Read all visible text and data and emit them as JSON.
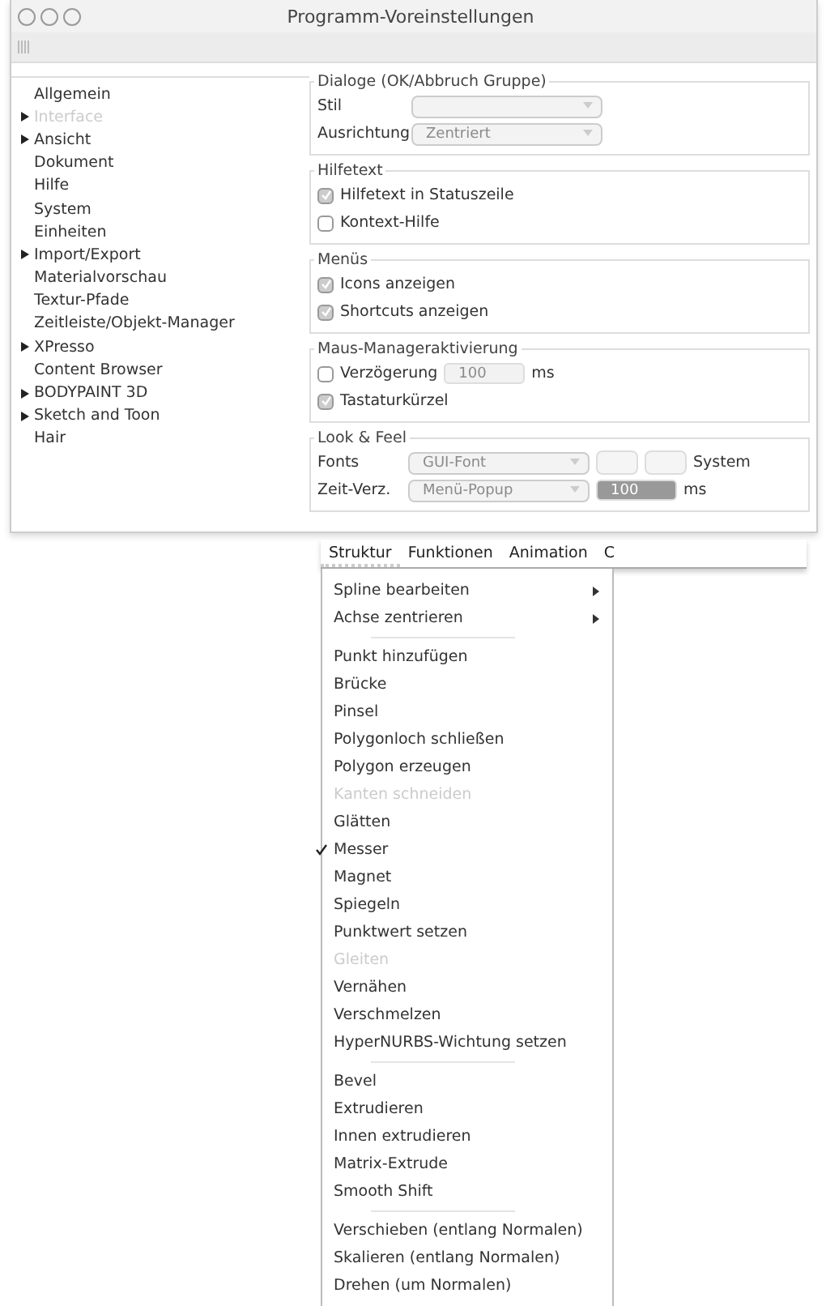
{
  "window": {
    "title": "Programm-Voreinstellungen"
  },
  "sidebar": {
    "items": [
      {
        "label": "Allgemein",
        "expandable": false,
        "disabled": false
      },
      {
        "label": "Interface",
        "expandable": true,
        "disabled": true
      },
      {
        "label": "Ansicht",
        "expandable": true,
        "disabled": false
      },
      {
        "label": "Dokument",
        "expandable": false,
        "disabled": false
      },
      {
        "label": "Hilfe",
        "expandable": false,
        "disabled": false
      },
      {
        "label": "System",
        "expandable": false,
        "disabled": false
      },
      {
        "label": "Einheiten",
        "expandable": false,
        "disabled": false
      },
      {
        "label": "Import/Export",
        "expandable": true,
        "disabled": false
      },
      {
        "label": "Materialvorschau",
        "expandable": false,
        "disabled": false
      },
      {
        "label": "Textur-Pfade",
        "expandable": false,
        "disabled": false
      },
      {
        "label": "Zeitleiste/Objekt-Manager",
        "expandable": false,
        "disabled": false
      },
      {
        "label": "XPresso",
        "expandable": true,
        "disabled": false
      },
      {
        "label": "Content Browser",
        "expandable": false,
        "disabled": false
      },
      {
        "label": "BODYPAINT 3D",
        "expandable": true,
        "disabled": false
      },
      {
        "label": "Sketch and Toon",
        "expandable": true,
        "disabled": false
      },
      {
        "label": "Hair",
        "expandable": false,
        "disabled": false
      }
    ]
  },
  "groups": [
    {
      "title": "Dialoge (OK/Abbruch Gruppe)",
      "rows": [
        {
          "kind": "select",
          "label": "Stil"
        },
        {
          "kind": "select",
          "label": "Ausrichtung",
          "value": "Zentriert"
        }
      ]
    },
    {
      "title": "Hilfetext",
      "rows": [
        {
          "kind": "checkbox",
          "label": "Hilfetext in Statuszeile",
          "checked": true
        },
        {
          "kind": "checkbox",
          "label": "Kontext-Hilfe",
          "checked": false
        }
      ]
    },
    {
      "title": "Menüs",
      "rows": [
        {
          "kind": "checkbox",
          "label": "Icons anzeigen",
          "checked": true
        },
        {
          "kind": "checkbox",
          "label": "Shortcuts anzeigen",
          "checked": true
        }
      ]
    },
    {
      "title": "Maus-Manageraktivierung",
      "rows": [
        {
          "kind": "checkbox_number",
          "label": "Verzögerung",
          "checked": false,
          "value": "100",
          "unit": "ms"
        },
        {
          "kind": "checkbox",
          "label": "Tastaturkürzel",
          "checked": true
        }
      ]
    },
    {
      "title": "Look & Feel",
      "rows": [
        {
          "kind": "font",
          "label": "Fonts",
          "value": "GUI-Font",
          "suffix": "System"
        },
        {
          "kind": "select_number",
          "label": "Zeit-Verz.",
          "value": "Menü-Popup",
          "number": "100",
          "unit": "ms"
        }
      ]
    }
  ],
  "menubar": [
    {
      "label": "Struktur",
      "selected": true
    },
    {
      "label": "Funktionen",
      "selected": false
    },
    {
      "label": "Animation",
      "selected": false
    },
    {
      "label": "C",
      "selected": false
    }
  ],
  "menu": [
    {
      "kind": "item",
      "label": "Spline bearbeiten",
      "submenu": true,
      "disabled": false,
      "checked": false
    },
    {
      "kind": "item",
      "label": "Achse zentrieren",
      "submenu": true,
      "disabled": false,
      "checked": false
    },
    {
      "kind": "separator"
    },
    {
      "kind": "item",
      "label": "Punkt hinzufügen",
      "submenu": false,
      "disabled": false,
      "checked": false
    },
    {
      "kind": "item",
      "label": "Brücke",
      "submenu": false,
      "disabled": false,
      "checked": false
    },
    {
      "kind": "item",
      "label": "Pinsel",
      "submenu": false,
      "disabled": false,
      "checked": false
    },
    {
      "kind": "item",
      "label": "Polygonloch schließen",
      "submenu": false,
      "disabled": false,
      "checked": false
    },
    {
      "kind": "item",
      "label": "Polygon erzeugen",
      "submenu": false,
      "disabled": false,
      "checked": false
    },
    {
      "kind": "item",
      "label": "Kanten schneiden",
      "submenu": false,
      "disabled": true,
      "checked": false
    },
    {
      "kind": "item",
      "label": "Glätten",
      "submenu": false,
      "disabled": false,
      "checked": false
    },
    {
      "kind": "item",
      "label": "Messer",
      "submenu": false,
      "disabled": false,
      "checked": true
    },
    {
      "kind": "item",
      "label": "Magnet",
      "submenu": false,
      "disabled": false,
      "checked": false
    },
    {
      "kind": "item",
      "label": "Spiegeln",
      "submenu": false,
      "disabled": false,
      "checked": false
    },
    {
      "kind": "item",
      "label": "Punktwert setzen",
      "submenu": false,
      "disabled": false,
      "checked": false
    },
    {
      "kind": "item",
      "label": "Gleiten",
      "submenu": false,
      "disabled": true,
      "checked": false
    },
    {
      "kind": "item",
      "label": "Vernähen",
      "submenu": false,
      "disabled": false,
      "checked": false
    },
    {
      "kind": "item",
      "label": "Verschmelzen",
      "submenu": false,
      "disabled": false,
      "checked": false
    },
    {
      "kind": "item",
      "label": "HyperNURBS-Wichtung setzen",
      "submenu": false,
      "disabled": false,
      "checked": false
    },
    {
      "kind": "separator"
    },
    {
      "kind": "item",
      "label": "Bevel",
      "submenu": false,
      "disabled": false,
      "checked": false
    },
    {
      "kind": "item",
      "label": "Extrudieren",
      "submenu": false,
      "disabled": false,
      "checked": false
    },
    {
      "kind": "item",
      "label": "Innen extrudieren",
      "submenu": false,
      "disabled": false,
      "checked": false
    },
    {
      "kind": "item",
      "label": "Matrix-Extrude",
      "submenu": false,
      "disabled": false,
      "checked": false
    },
    {
      "kind": "item",
      "label": "Smooth Shift",
      "submenu": false,
      "disabled": false,
      "checked": false
    },
    {
      "kind": "separator"
    },
    {
      "kind": "item",
      "label": "Verschieben (entlang Normalen)",
      "submenu": false,
      "disabled": false,
      "checked": false
    },
    {
      "kind": "item",
      "label": "Skalieren (entlang Normalen)",
      "submenu": false,
      "disabled": false,
      "checked": false
    },
    {
      "kind": "item",
      "label": "Drehen (um Normalen)",
      "submenu": false,
      "disabled": false,
      "checked": false
    }
  ]
}
